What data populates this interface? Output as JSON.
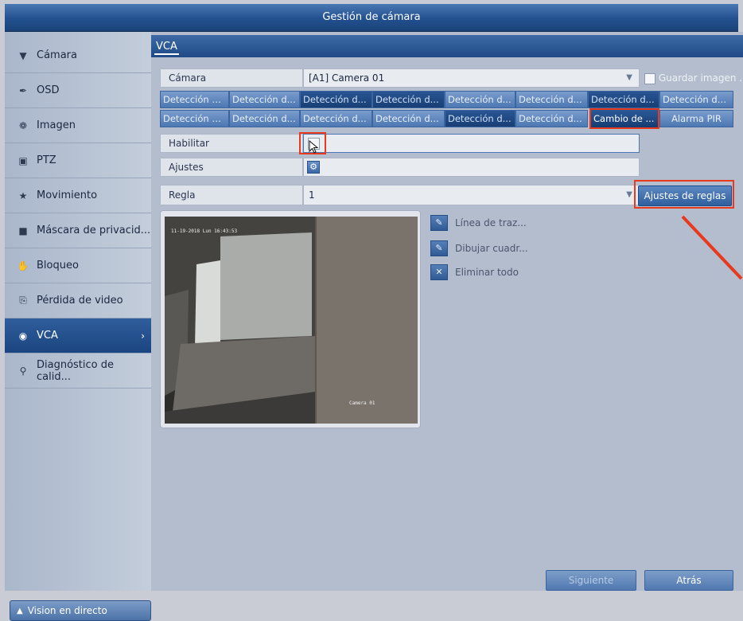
{
  "window": {
    "title": "Gestión de cámara"
  },
  "sidebar": {
    "items": [
      {
        "label": "Cámara",
        "icon": "camera-icon"
      },
      {
        "label": "OSD",
        "icon": "osd-icon"
      },
      {
        "label": "Imagen",
        "icon": "image-icon"
      },
      {
        "label": "PTZ",
        "icon": "ptz-icon"
      },
      {
        "label": "Movimiento",
        "icon": "motion-icon"
      },
      {
        "label": "Máscara de privacid...",
        "icon": "privacy-mask-icon"
      },
      {
        "label": "Bloqueo",
        "icon": "tamper-icon"
      },
      {
        "label": "Pérdida de video",
        "icon": "video-loss-icon"
      },
      {
        "label": "VCA",
        "icon": "vca-icon"
      },
      {
        "label": "Diagnóstico de calid...",
        "icon": "diagnosis-icon"
      }
    ],
    "live_view": "Vision en directo"
  },
  "main": {
    "tab": "VCA",
    "camera": {
      "label": "Cámara",
      "value": "[A1] Camera 01",
      "save_image": "Guardar imagen ..."
    },
    "detection_row1": [
      "Detección d...",
      "Detección d...",
      "Detección d...",
      "Detección d...",
      "Detección d...",
      "Detección d...",
      "Detección d...",
      "Detección de..."
    ],
    "detection_row2": [
      "Detección d...",
      "Detección d...",
      "Detección d...",
      "Detección d...",
      "Detección d...",
      "Detección d...",
      "Cambio de ...",
      "Alarma PIR"
    ],
    "enable": {
      "label": "Habilitar"
    },
    "settings": {
      "label": "Ajustes"
    },
    "rule": {
      "label": "Regla",
      "value": "1"
    },
    "rule_settings_button": "Ajustes de reglas",
    "tools": [
      "Línea de traz...",
      "Dibujar cuadr...",
      "Eliminar todo"
    ],
    "preview": {
      "timestamp": "11-19-2018 Lun 16:43:53",
      "channel": "Camera 01"
    },
    "footer": {
      "next": "Siguiente",
      "back": "Atrás"
    }
  },
  "colors": {
    "accent": "#1f4a87",
    "highlight": "#e8391d"
  }
}
